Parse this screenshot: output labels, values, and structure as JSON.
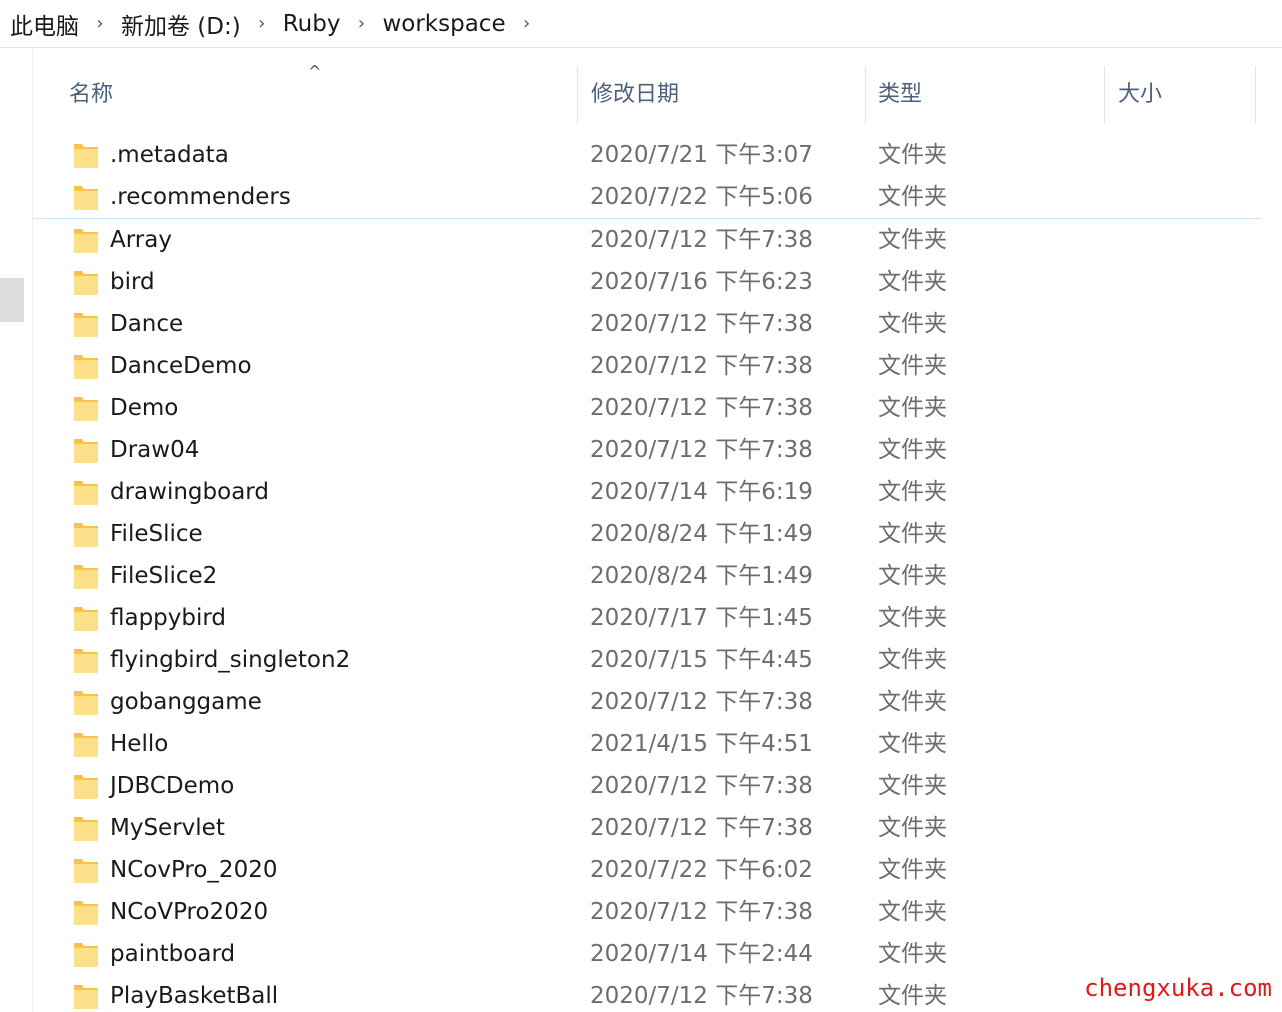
{
  "breadcrumb": {
    "items": [
      "此电脑",
      "新加卷 (D:)",
      "Ruby",
      "workspace"
    ],
    "separator": "›"
  },
  "columns": {
    "name": "名称",
    "date": "修改日期",
    "type": "类型",
    "size": "大小",
    "sort_indicator": "^"
  },
  "files": [
    {
      "name": ".metadata",
      "date": "2020/7/21 下午3:07",
      "type": "文件夹"
    },
    {
      "name": ".recommenders",
      "date": "2020/7/22 下午5:06",
      "type": "文件夹"
    },
    {
      "name": "Array",
      "date": "2020/7/12 下午7:38",
      "type": "文件夹"
    },
    {
      "name": "bird",
      "date": "2020/7/16 下午6:23",
      "type": "文件夹"
    },
    {
      "name": "Dance",
      "date": "2020/7/12 下午7:38",
      "type": "文件夹"
    },
    {
      "name": "DanceDemo",
      "date": "2020/7/12 下午7:38",
      "type": "文件夹"
    },
    {
      "name": "Demo",
      "date": "2020/7/12 下午7:38",
      "type": "文件夹"
    },
    {
      "name": "Draw04",
      "date": "2020/7/12 下午7:38",
      "type": "文件夹"
    },
    {
      "name": "drawingboard",
      "date": "2020/7/14 下午6:19",
      "type": "文件夹"
    },
    {
      "name": "FileSlice",
      "date": "2020/8/24 下午1:49",
      "type": "文件夹"
    },
    {
      "name": "FileSlice2",
      "date": "2020/8/24 下午1:49",
      "type": "文件夹"
    },
    {
      "name": "flappybird",
      "date": "2020/7/17 下午1:45",
      "type": "文件夹"
    },
    {
      "name": "flyingbird_singleton2",
      "date": "2020/7/15 下午4:45",
      "type": "文件夹"
    },
    {
      "name": "gobanggame",
      "date": "2020/7/12 下午7:38",
      "type": "文件夹"
    },
    {
      "name": "Hello",
      "date": "2021/4/15 下午4:51",
      "type": "文件夹"
    },
    {
      "name": "JDBCDemo",
      "date": "2020/7/12 下午7:38",
      "type": "文件夹"
    },
    {
      "name": "MyServlet",
      "date": "2020/7/12 下午7:38",
      "type": "文件夹"
    },
    {
      "name": "NCovPro_2020",
      "date": "2020/7/22 下午6:02",
      "type": "文件夹"
    },
    {
      "name": "NCoVPro2020",
      "date": "2020/7/12 下午7:38",
      "type": "文件夹"
    },
    {
      "name": "paintboard",
      "date": "2020/7/14 下午2:44",
      "type": "文件夹"
    },
    {
      "name": "PlayBasketBall",
      "date": "2020/7/12 下午7:38",
      "type": "文件夹"
    }
  ],
  "watermark": "chengxuka.com",
  "colors": {
    "folder_fill": "#ffe08a",
    "folder_back": "#f4c54a",
    "header_text": "#4c607a",
    "watermark": "#e0191b"
  }
}
